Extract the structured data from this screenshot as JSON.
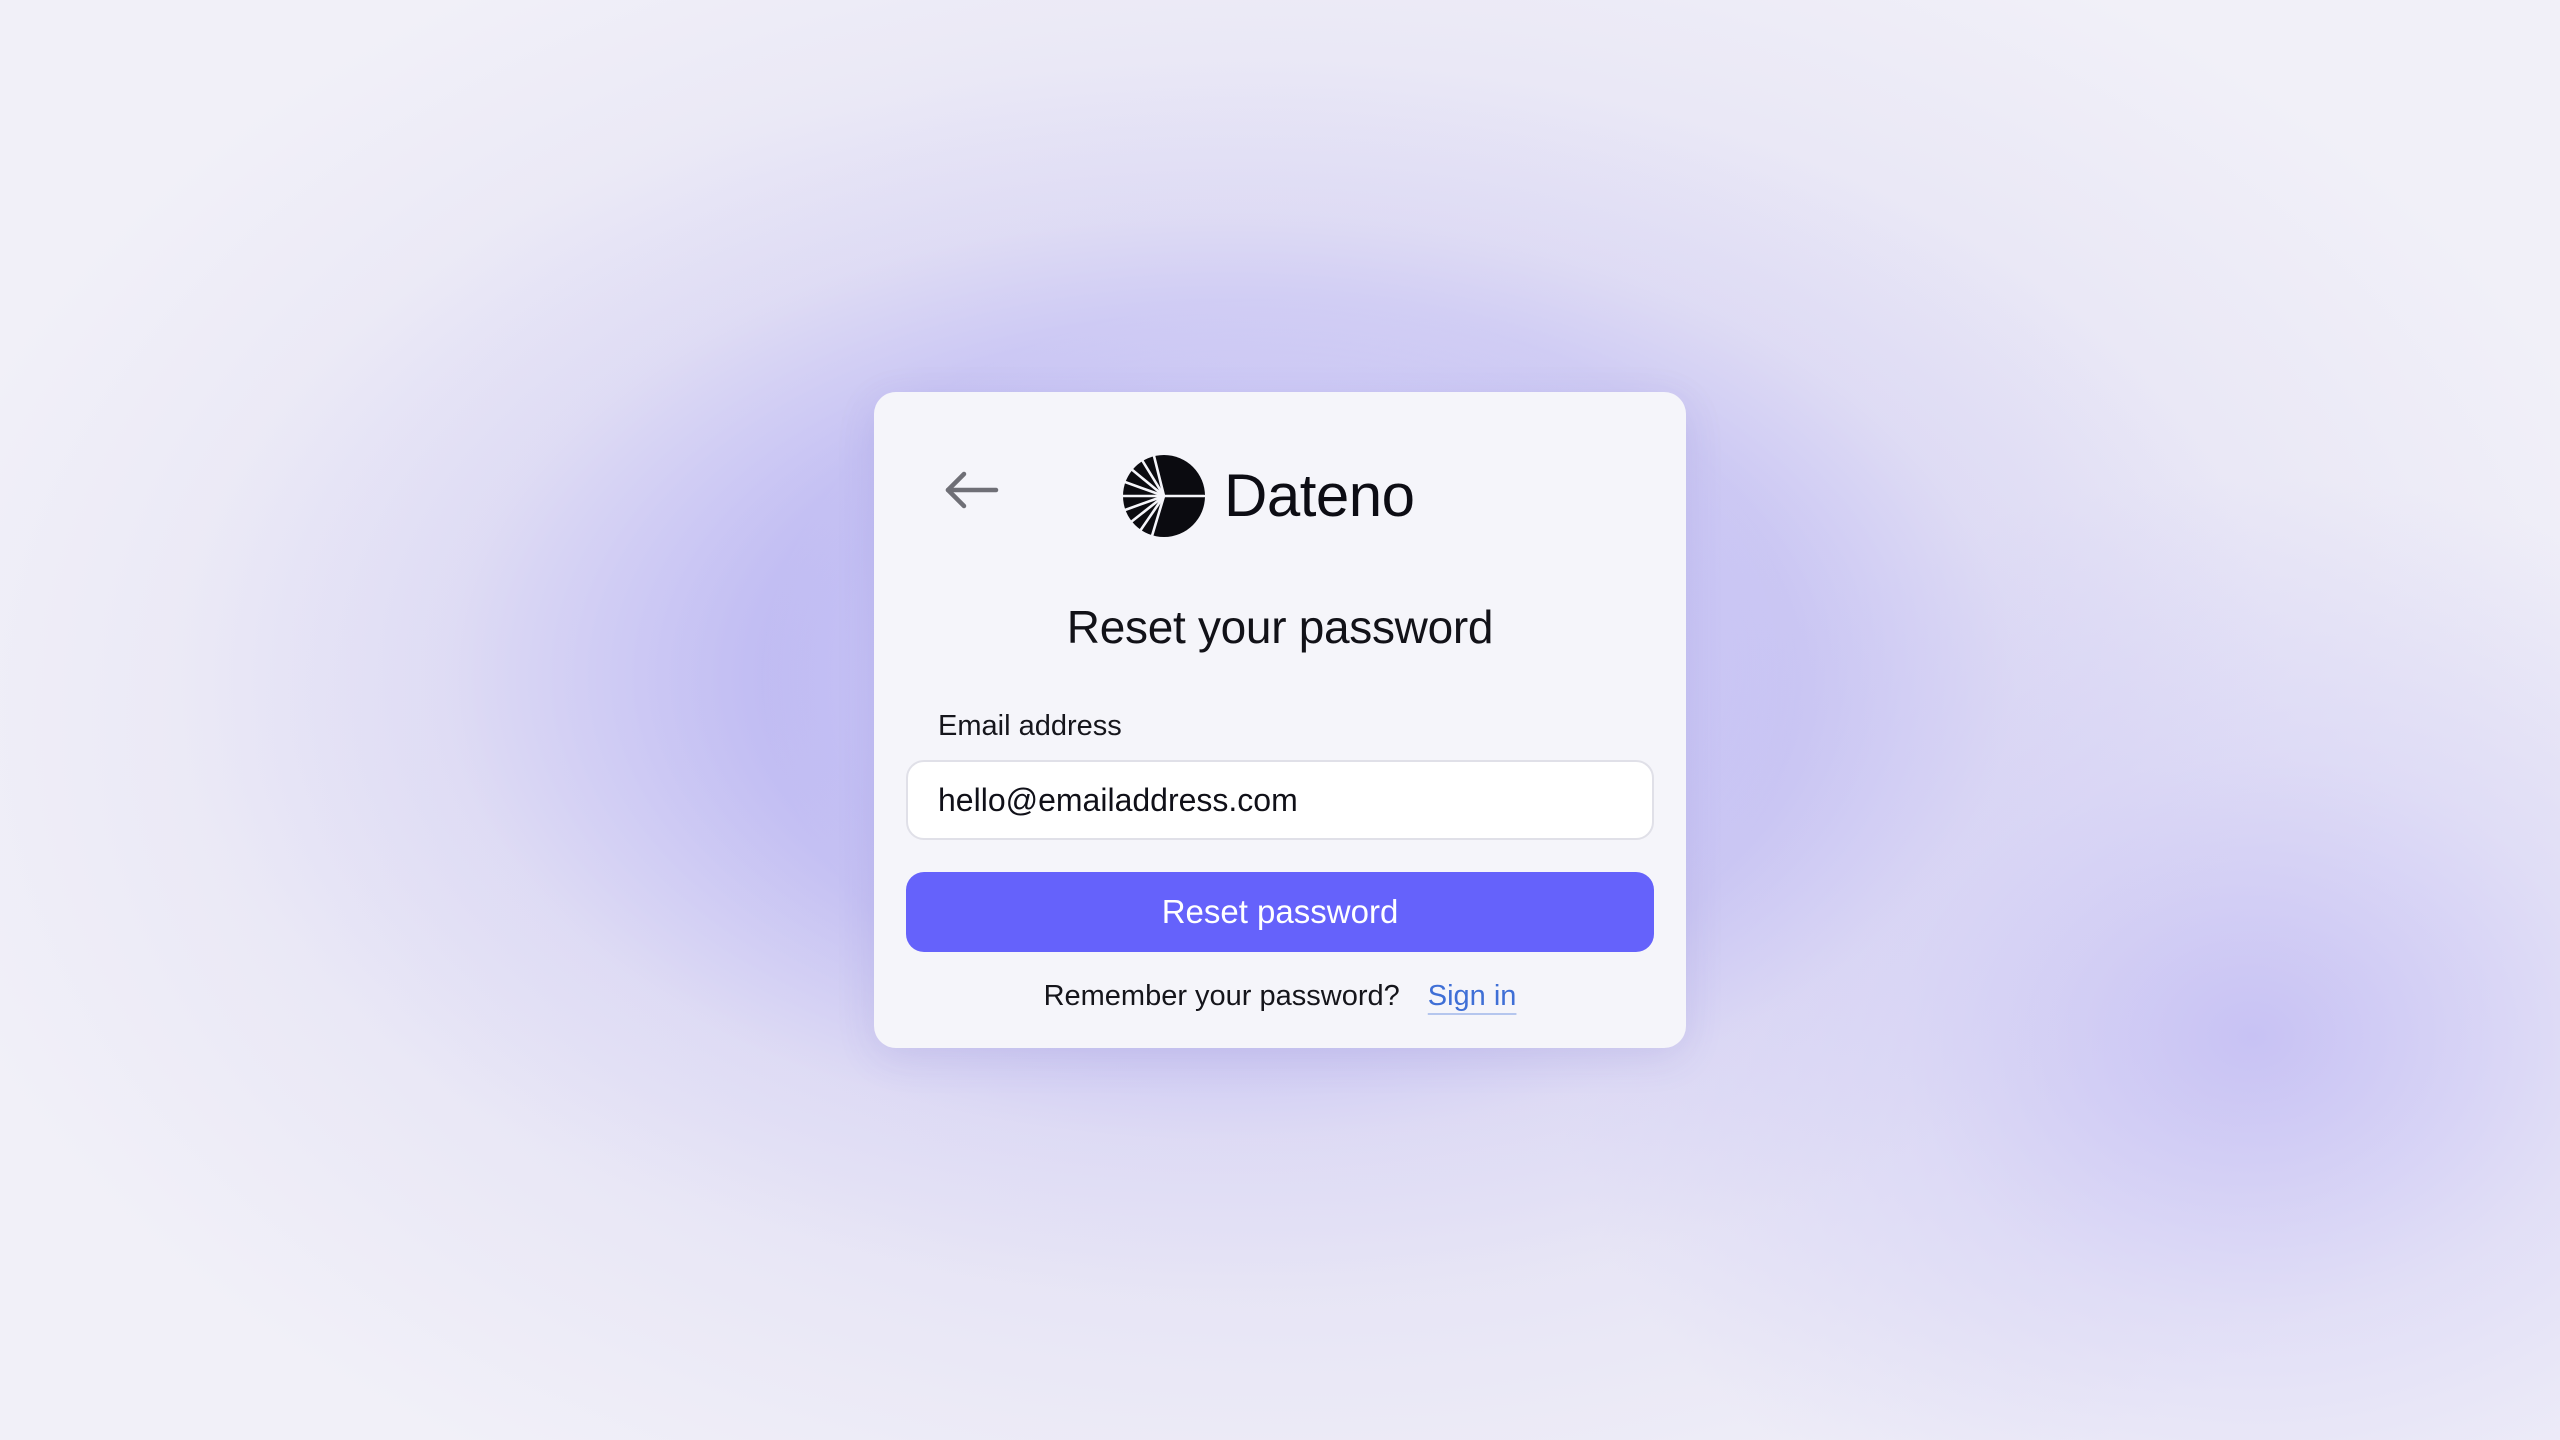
{
  "brand": {
    "name": "Dateno",
    "logo_icon": "dateno-logo-icon"
  },
  "header": {
    "back_icon": "arrow-left-icon"
  },
  "form": {
    "title": "Reset your password",
    "email_label": "Email address",
    "email_value": "hello@emailaddress.com",
    "submit_label": "Reset password"
  },
  "footer": {
    "prompt": "Remember your password?",
    "link_label": "Sign in"
  },
  "colors": {
    "accent": "#6562fb",
    "link": "#3f6fd6",
    "card_bg": "#f5f5fa",
    "text": "#121218"
  }
}
